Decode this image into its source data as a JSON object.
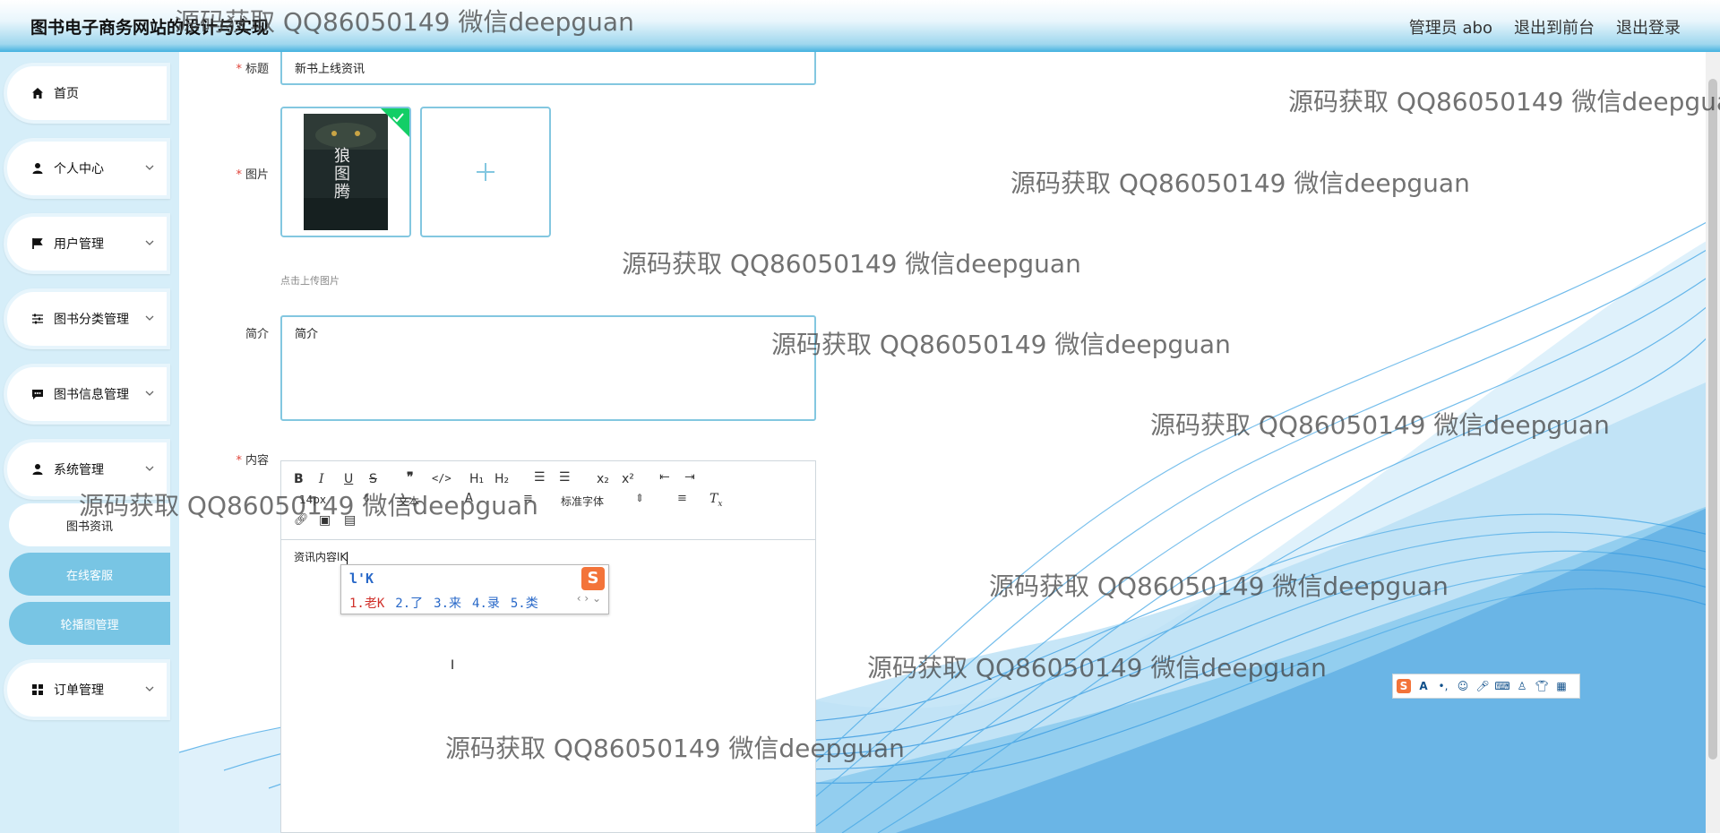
{
  "header": {
    "site_title": "图书电子商务网站的设计与实现",
    "admin_label": "管理员 abo",
    "back_to_front": "退出到前台",
    "logout": "退出登录"
  },
  "sidebar": {
    "items": [
      {
        "label": "首页",
        "icon": "home-icon"
      },
      {
        "label": "个人中心",
        "icon": "user-icon"
      },
      {
        "label": "用户管理",
        "icon": "flag-icon"
      },
      {
        "label": "图书分类管理",
        "icon": "sliders-icon"
      },
      {
        "label": "图书信息管理",
        "icon": "chat-icon"
      },
      {
        "label": "系统管理",
        "icon": "user-icon"
      },
      {
        "label": "订单管理",
        "icon": "grid-icon"
      }
    ],
    "sub_items": [
      {
        "label": "图书资讯",
        "active": true
      },
      {
        "label": "在线客服",
        "active": false
      },
      {
        "label": "轮播图管理",
        "active": false
      }
    ]
  },
  "form": {
    "title_label": "标题",
    "title_value": "新书上线资讯",
    "image_label": "图片",
    "upload_hint": "点击上传图片",
    "intro_label": "简介",
    "intro_value": "简介",
    "content_label": "内容",
    "book_cover_title": "狼图腾"
  },
  "editor": {
    "toolbar_text": {
      "h1": "H₁",
      "h2": "H₂",
      "sub": "x₂",
      "sup": "x²",
      "font_select": "标准字体",
      "size_select": "14px",
      "text_select": "文本"
    },
    "content_text": "资讯内容lK"
  },
  "ime": {
    "pinyin": "l'K",
    "candidates": [
      "1.老K",
      "2.了",
      "3.来",
      "4.录",
      "5.类"
    ]
  },
  "watermark_text": "源码获取 QQ86050149 微信deepguan",
  "colors": {
    "accent": "#43b2e0",
    "sidebar_bg": "#d6eef9",
    "sub_item_bg": "#78c5e4",
    "required": "#e0443a"
  }
}
